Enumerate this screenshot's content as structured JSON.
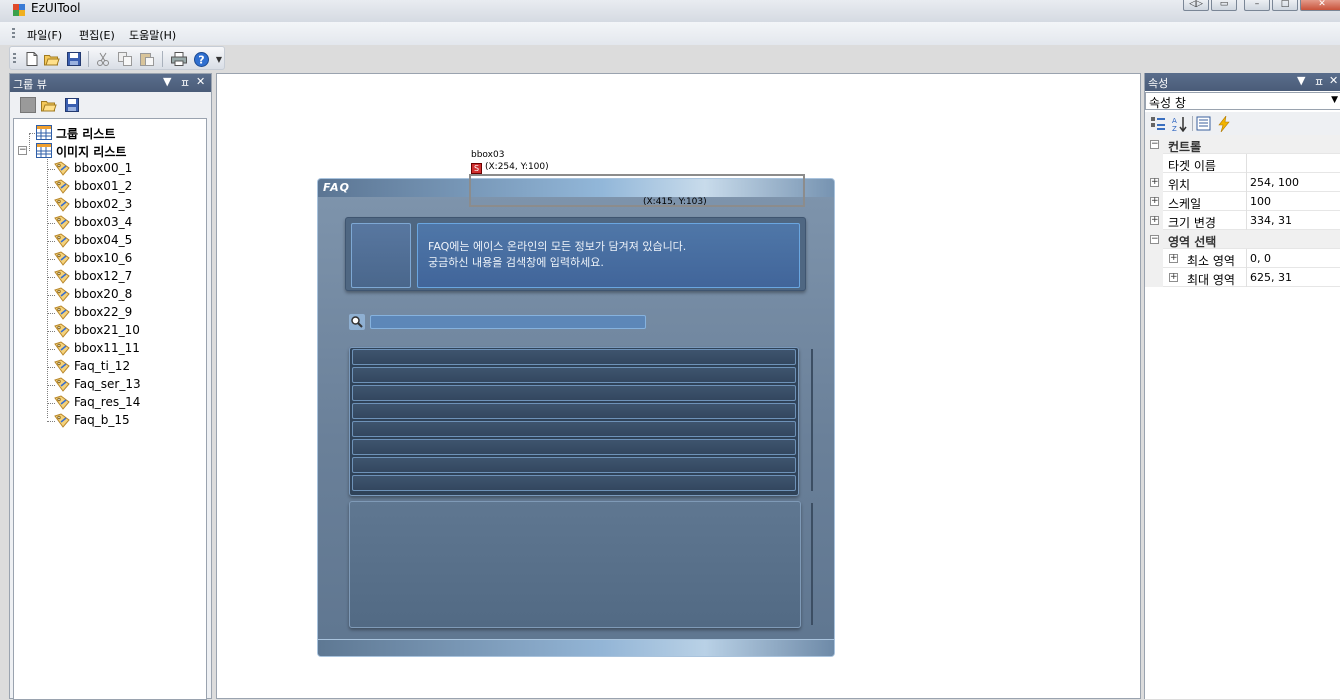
{
  "window": {
    "title": "EzUITool"
  },
  "menu": {
    "items": [
      "파일(F)",
      "편집(E)",
      "도움말(H)"
    ]
  },
  "toolbar": {
    "buttons": [
      "new-file-icon",
      "open-folder-icon",
      "save-icon",
      "cut-icon",
      "copy-icon",
      "paste-icon",
      "print-icon",
      "help-icon"
    ]
  },
  "group_view": {
    "title": "그룹 뷰",
    "tree": {
      "group_list_label": "그룹 리스트",
      "image_list_label": "이미지 리스트",
      "items": [
        "bbox00_1",
        "bbox01_2",
        "bbox02_3",
        "bbox03_4",
        "bbox04_5",
        "bbox10_6",
        "bbox12_7",
        "bbox20_8",
        "bbox22_9",
        "bbox21_10",
        "bbox11_11",
        "Faq_ti_12",
        "Faq_ser_13",
        "Faq_res_14",
        "Faq_b_15"
      ]
    }
  },
  "canvas": {
    "selection": {
      "name": "bbox03",
      "marker": "S",
      "start_label": "(X:254, Y:100)",
      "end_label": "(X:415, Y:103)"
    },
    "faq": {
      "title": "FAQ",
      "info_line_1": "FAQ에는 에이스 온라인의 모든 정보가 담겨져 있습니다.",
      "info_line_2": "궁금하신 내용을 검색창에 입력하세요.",
      "list_row_count": 8
    }
  },
  "properties": {
    "title": "속성",
    "selector": "속성 창",
    "rows": [
      {
        "kind": "category",
        "name": "컨트롤",
        "expander": "⊟"
      },
      {
        "kind": "prop",
        "name": "타겟 이름",
        "value": ""
      },
      {
        "kind": "prop",
        "name": "위치",
        "value": "254, 100",
        "expander": "⊞"
      },
      {
        "kind": "prop",
        "name": "스케일",
        "value": "100",
        "expander": "⊞"
      },
      {
        "kind": "prop",
        "name": "크기 변경",
        "value": "334, 31",
        "expander": "⊞"
      },
      {
        "kind": "category",
        "name": "영역 선택",
        "expander": "⊟"
      },
      {
        "kind": "sub",
        "name": "최소 영역",
        "value": "0, 0",
        "expander": "⊞"
      },
      {
        "kind": "sub",
        "name": "최대 영역",
        "value": "625, 31",
        "expander": "⊞"
      }
    ]
  },
  "colors": {
    "pane_header": "#5a6e8c",
    "faq_panel": "#6a8099",
    "selection_marker": "#d03030"
  }
}
